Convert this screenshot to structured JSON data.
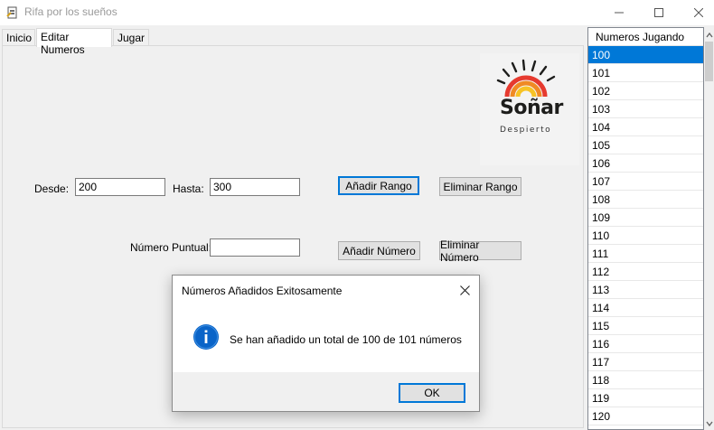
{
  "window": {
    "title": "Rifa por los sueños",
    "controls": {
      "minimize": "—",
      "maximize": "☐",
      "close": "✕"
    }
  },
  "tabs": [
    {
      "label": "Inicio",
      "active": false
    },
    {
      "label": "Editar Numeros",
      "active": true
    },
    {
      "label": "Jugar",
      "active": false
    }
  ],
  "logo": {
    "word": "Soñar",
    "subtitle": "Despierto",
    "colors": {
      "ray": "#1d1d1b",
      "arc_outer": "#e63a2f",
      "arc_mid": "#f08a24",
      "arc_inner": "#f7c325"
    }
  },
  "range_form": {
    "desde_label": "Desde:",
    "desde_value": "200",
    "hasta_label": "Hasta:",
    "hasta_value": "300",
    "add_range": "Añadir Rango",
    "remove_range": "Eliminar Rango"
  },
  "single_form": {
    "label": "Número Puntual:",
    "value": "",
    "add_number": "Añadir Número",
    "remove_number": "Eliminar Número"
  },
  "numbers_list": {
    "header": "Numeros Jugando",
    "selected": "100",
    "items": [
      "100",
      "101",
      "102",
      "103",
      "104",
      "105",
      "106",
      "107",
      "108",
      "109",
      "110",
      "111",
      "112",
      "113",
      "114",
      "115",
      "116",
      "117",
      "118",
      "119",
      "120"
    ]
  },
  "dialog": {
    "title": "Números Añadidos Exitosamente",
    "message": "Se han añadido un total de 100 de 101 números",
    "ok": "OK",
    "close": "✕",
    "icon": "info-icon",
    "icon_color": "#0a64c8"
  }
}
